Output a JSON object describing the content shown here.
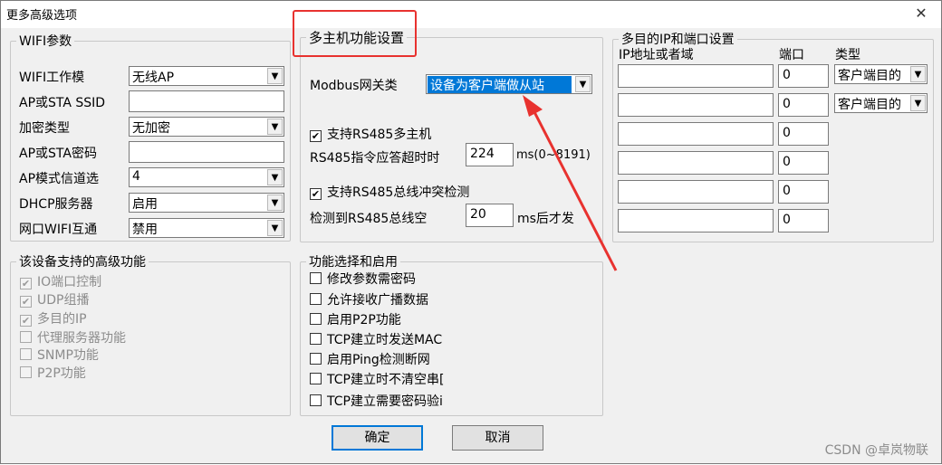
{
  "window": {
    "title": "更多高级选项",
    "close_glyph": "✕"
  },
  "wifi": {
    "legend": "WIFI参数",
    "rows": [
      {
        "label": "WIFI工作模",
        "type": "combo",
        "value": "无线AP"
      },
      {
        "label": "AP或STA SSID",
        "type": "text",
        "value": ""
      },
      {
        "label": "加密类型",
        "type": "combo",
        "value": "无加密"
      },
      {
        "label": "AP或STA密码",
        "type": "text",
        "value": ""
      },
      {
        "label": "AP模式信道选",
        "type": "combo",
        "value": "4"
      },
      {
        "label": "DHCP服务器",
        "type": "combo",
        "value": "启用"
      },
      {
        "label": "网口WIFI互通",
        "type": "combo",
        "value": "禁用"
      }
    ]
  },
  "multihost": {
    "legend": "多主机功能设置",
    "modbus_label": "Modbus网关类",
    "modbus_value": "设备为客户端做从站",
    "rs485_multi": {
      "label": "支持RS485多主机",
      "checked": true
    },
    "timeout_label": "RS485指令应答超时时",
    "timeout_value": "224",
    "timeout_unit": "ms(0~8191)",
    "collision": {
      "label": "支持RS485总线冲突检测",
      "checked": true
    },
    "idle_label": "检测到RS485总线空",
    "idle_value": "20",
    "idle_unit": "ms后才发"
  },
  "multiip": {
    "legend": "多目的IP和端口设置",
    "col_ip": "IP地址或者域",
    "col_port": "端口",
    "col_type": "类型",
    "rows": [
      {
        "ip": "",
        "port": "0",
        "type": "客户端目的"
      },
      {
        "ip": "",
        "port": "0",
        "type": "客户端目的"
      },
      {
        "ip": "",
        "port": "0"
      },
      {
        "ip": "",
        "port": "0"
      },
      {
        "ip": "",
        "port": "0"
      },
      {
        "ip": "",
        "port": "0"
      }
    ]
  },
  "advanced": {
    "legend": "该设备支持的高级功能",
    "items": [
      {
        "label": "IO端口控制",
        "checked": true
      },
      {
        "label": "UDP组播",
        "checked": true
      },
      {
        "label": "多目的IP",
        "checked": true
      },
      {
        "label": "代理服务器功能",
        "checked": false
      },
      {
        "label": "SNMP功能",
        "checked": false
      },
      {
        "label": "P2P功能",
        "checked": false
      }
    ]
  },
  "funcs": {
    "legend": "功能选择和启用",
    "items": [
      {
        "label": "修改参数需密码",
        "checked": false
      },
      {
        "label": "允许接收广播数据",
        "checked": false
      },
      {
        "label": "启用P2P功能",
        "checked": false
      },
      {
        "label": "TCP建立时发送MAC",
        "checked": false
      },
      {
        "label": "启用Ping检测断网",
        "checked": false
      },
      {
        "label": "TCP建立时不清空串[",
        "checked": false
      },
      {
        "label": "TCP建立需要密码验i",
        "checked": false
      }
    ]
  },
  "buttons": {
    "ok": "确定",
    "cancel": "取消"
  },
  "annotation": {
    "color": "#e8322f"
  },
  "watermark": "CSDN @卓岚物联",
  "colors": {
    "selection": "#0078d7",
    "dialog_bg": "#f0f0f0",
    "annotation": "#e8322f"
  },
  "icons": {
    "checkbox_checked": "check-icon",
    "dropdown": "chevron-down-icon",
    "close": "close-icon"
  }
}
